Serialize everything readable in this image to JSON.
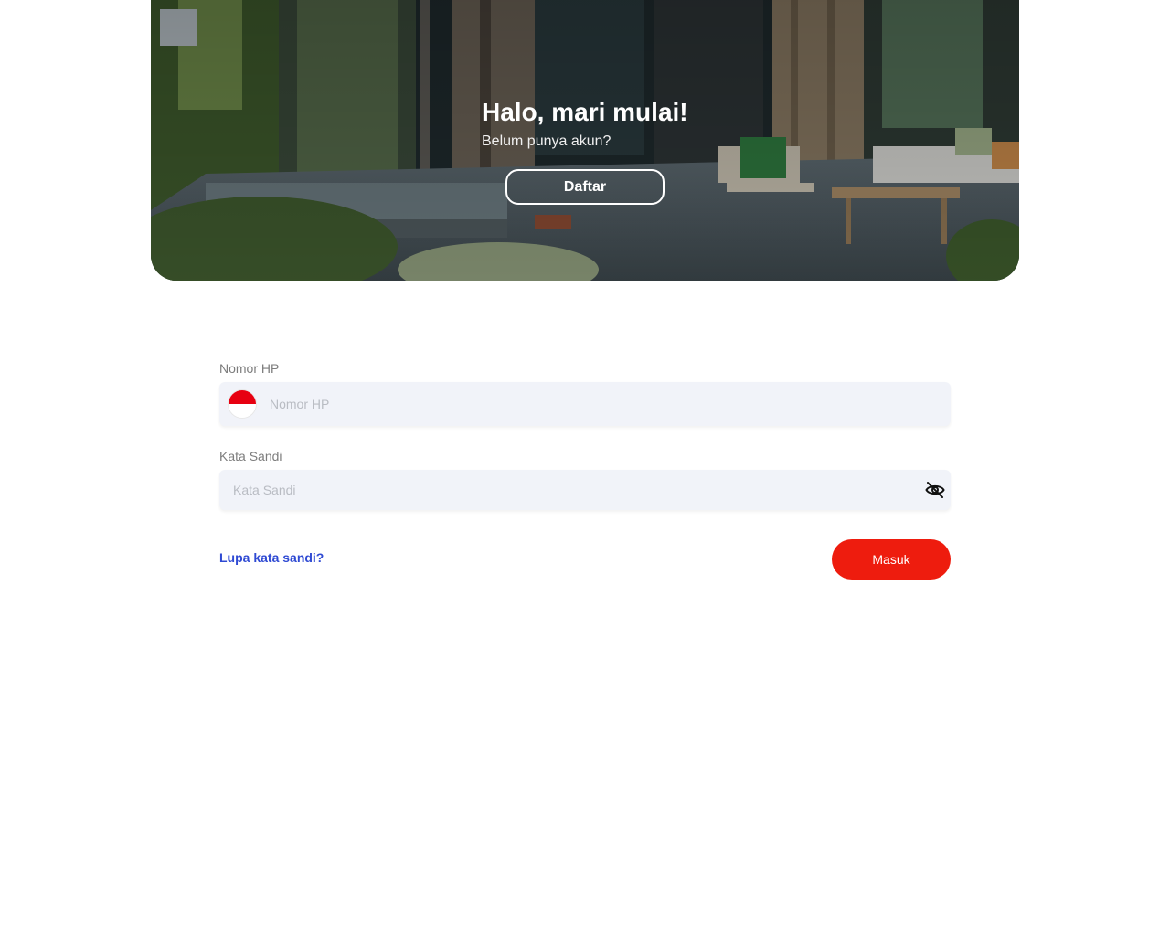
{
  "hero": {
    "title": "Halo, mari mulai!",
    "subtitle": "Belum punya akun?",
    "register_label": "Daftar"
  },
  "form": {
    "phone": {
      "label": "Nomor HP",
      "placeholder": "Nomor HP",
      "value": "",
      "flag": "indonesia-flag-icon"
    },
    "password": {
      "label": "Kata Sandi",
      "placeholder": "Kata Sandi",
      "value": "",
      "toggle_icon": "eye-off-icon"
    },
    "forgot_label": "Lupa kata sandi?",
    "login_label": "Masuk"
  },
  "colors": {
    "primary": "#ee1c0e",
    "link": "#2f4ad3",
    "field_bg": "#f1f3f9",
    "flag_red": "#e70011"
  }
}
